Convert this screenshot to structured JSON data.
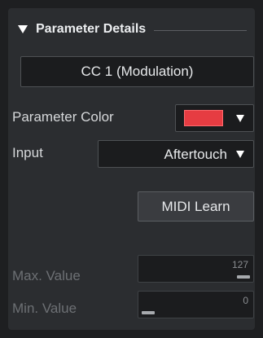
{
  "section": {
    "title": "Parameter Details"
  },
  "parameter": {
    "button_label": "CC 1  (Modulation)"
  },
  "color_row": {
    "label": "Parameter Color",
    "swatch_color": "#e63c42"
  },
  "input_row": {
    "label": "Input",
    "value": "Aftertouch"
  },
  "midi_learn": {
    "label": "MIDI Learn"
  },
  "max_value": {
    "label": "Max. Value",
    "value": "127",
    "level": 1.0
  },
  "min_value": {
    "label": "Min. Value",
    "value": "0",
    "level": 0.0
  }
}
